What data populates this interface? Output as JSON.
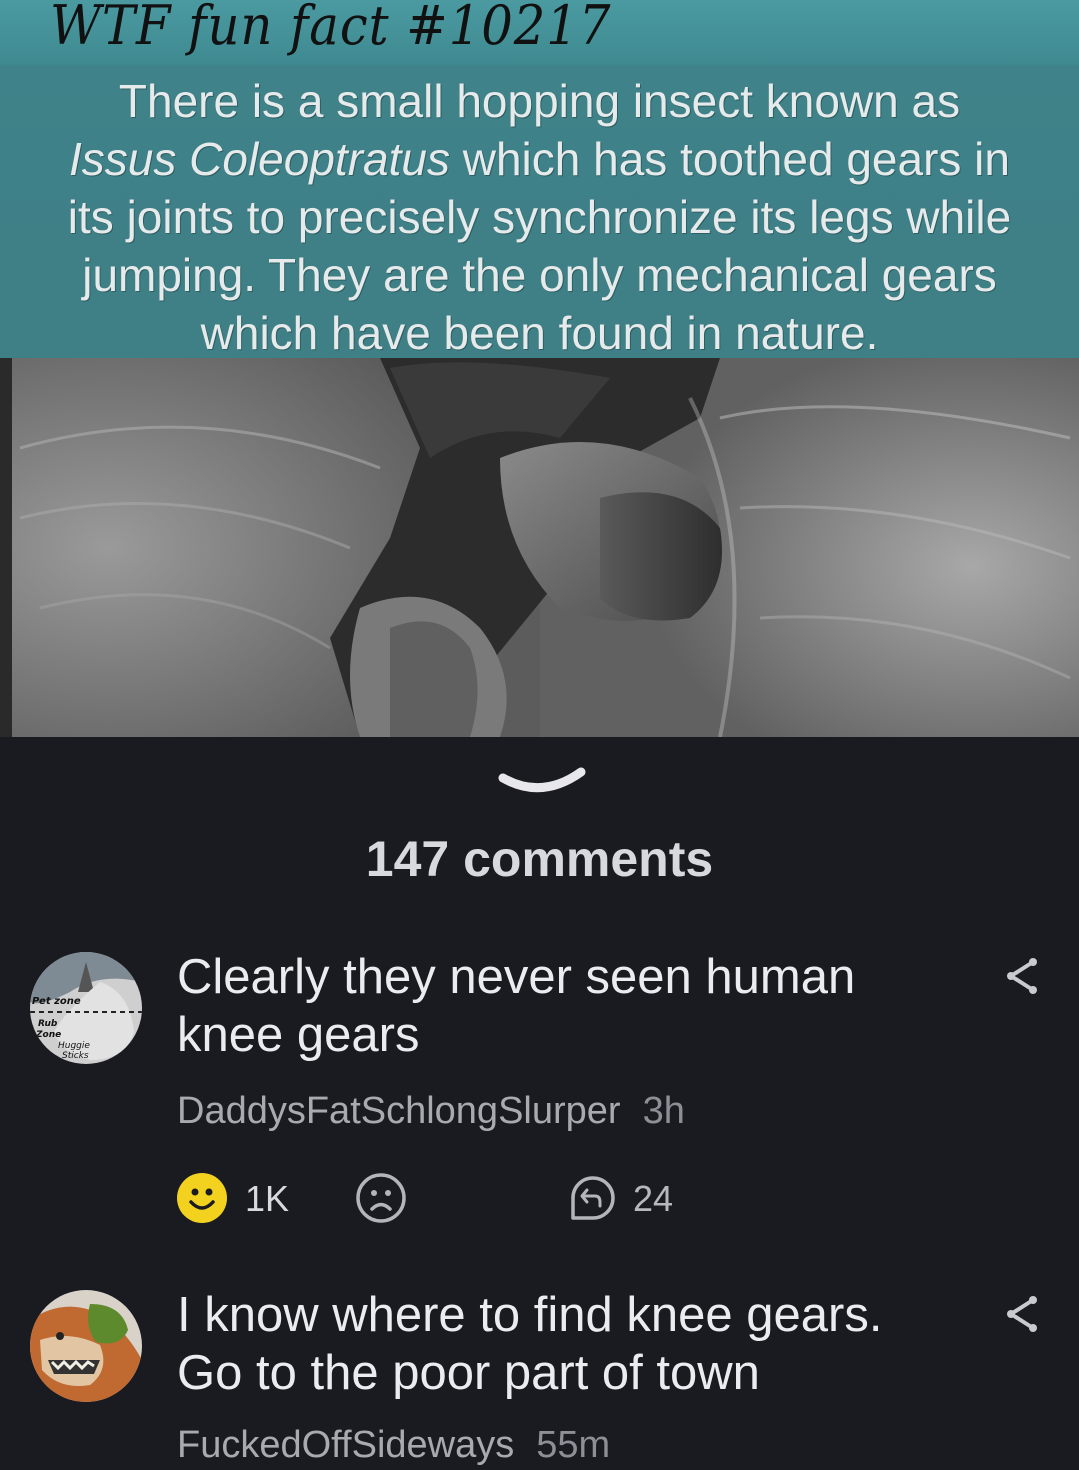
{
  "post": {
    "meme_title": "WTF fun fact #10217",
    "meme_fact_lines": {
      "l1": "There is a small hopping insect known as",
      "l2_sci": "Issus Coleoptratus",
      "l2_rest": " which has toothed gears in",
      "l3": "its joints to precisely synchronize its legs while",
      "l4": "jumping.  They are the only mechanical gears",
      "l5": "which have been found in nature."
    },
    "photo_icon": "gear-micrograph"
  },
  "comments_header": {
    "count_label": "147 comments",
    "collapse_icon": "chevron-down-icon"
  },
  "avatar1_text": {
    "a": "Pet zone",
    "b": "Rub",
    "c": "Zone",
    "d": "Huggie",
    "e": "Sticks"
  },
  "comments": [
    {
      "line1": "Clearly they never seen human",
      "line2": "knee gears",
      "author": "DaddysFatSchlongSlurper",
      "time": "3h",
      "likes": "1K",
      "replies": "24"
    },
    {
      "line1": "I know where to find knee gears.",
      "line2": "Go to the poor part of town",
      "author": "FuckedOffSideways",
      "time": "55m"
    }
  ],
  "colors": {
    "background": "#1a1b20",
    "meme_teal": "#3f8289",
    "like_yellow": "#f2d21e",
    "text_primary": "#ececf0",
    "text_meta": "#a9aab0"
  }
}
